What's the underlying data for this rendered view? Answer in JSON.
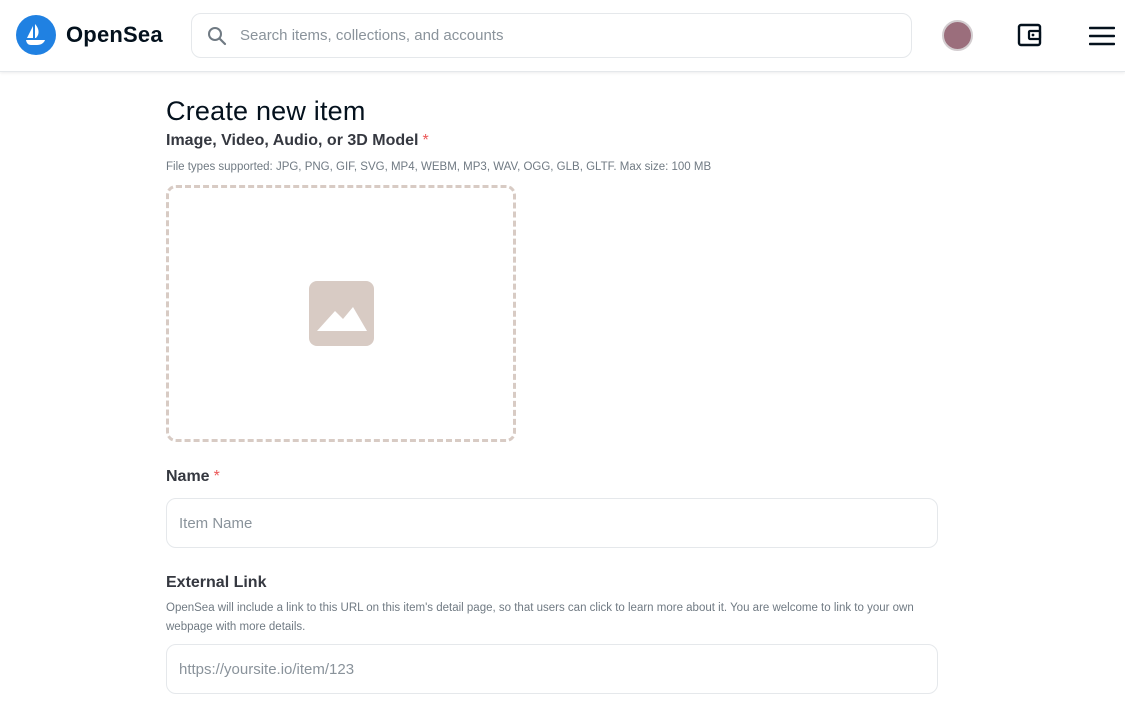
{
  "header": {
    "logo_text": "OpenSea",
    "search": {
      "placeholder": "Search items, collections, and accounts",
      "value": ""
    },
    "icons": {
      "logo": "opensea-ship-logo-icon",
      "search": "search-icon",
      "wallet": "wallet-icon",
      "menu": "hamburger-menu-icon"
    },
    "avatar_color": "#9b6e7c"
  },
  "form": {
    "title": "Create new item",
    "media": {
      "label": "Image, Video, Audio, or 3D Model",
      "required_mark": "*",
      "hint": "File types supported: JPG, PNG, GIF, SVG, MP4, WEBM, MP3, WAV, OGG, GLB, GLTF. Max size: 100 MB",
      "dropzone_icon": "image-placeholder-icon"
    },
    "name": {
      "label": "Name",
      "required_mark": "*",
      "placeholder": "Item Name",
      "value": ""
    },
    "external_link": {
      "label": "External Link",
      "hint": "OpenSea will include a link to this URL on this item's detail page, so that users can click to learn more about it. You are welcome to link to your own webpage with more details.",
      "placeholder": "https://yoursite.io/item/123",
      "value": ""
    }
  },
  "colors": {
    "brand_blue": "#2081e2",
    "required_red": "#eb5757",
    "dropzone_border": "#d8cbc4"
  }
}
